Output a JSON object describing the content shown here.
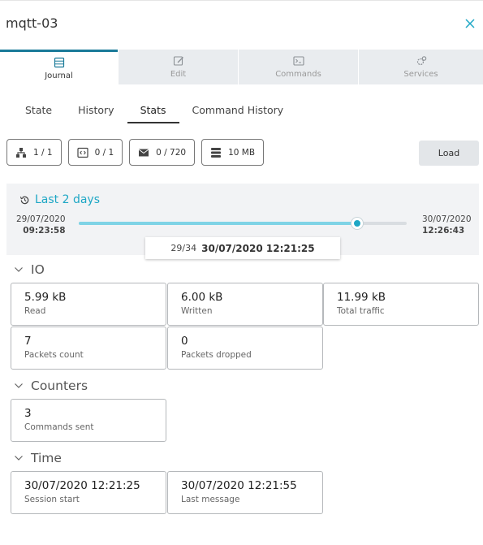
{
  "header": {
    "title": "mqtt-03",
    "close_icon": "close-icon"
  },
  "main_tabs": [
    {
      "label": "Journal",
      "icon": "journal-icon",
      "active": true
    },
    {
      "label": "Edit",
      "icon": "edit-icon",
      "active": false
    },
    {
      "label": "Commands",
      "icon": "terminal-icon",
      "active": false
    },
    {
      "label": "Services",
      "icon": "services-icon",
      "active": false
    }
  ],
  "sub_tabs": [
    {
      "label": "State",
      "active": false
    },
    {
      "label": "History",
      "active": false
    },
    {
      "label": "Stats",
      "active": true
    },
    {
      "label": "Command History",
      "active": false
    }
  ],
  "chips": [
    {
      "icon": "network-icon",
      "text": "1 / 1"
    },
    {
      "icon": "code-icon",
      "text": "0 / 1"
    },
    {
      "icon": "mail-icon",
      "text": "0 / 720"
    },
    {
      "icon": "storage-icon",
      "text": "10 MB"
    }
  ],
  "load_button": "Load",
  "range": {
    "label": "Last 2 days",
    "start_date": "29/07/2020",
    "start_time": "09:23:58",
    "end_date": "30/07/2020",
    "end_time": "12:26:43",
    "slider_fraction": 0.85,
    "tooltip_position": "29/34",
    "tooltip_time": "30/07/2020 12:21:25"
  },
  "sections": {
    "io": {
      "title": "IO",
      "cards": [
        {
          "value": "5.99 kB",
          "label": "Read"
        },
        {
          "value": "6.00 kB",
          "label": "Written"
        },
        {
          "value": "11.99 kB",
          "label": "Total traffic"
        },
        {
          "value": "7",
          "label": "Packets count"
        },
        {
          "value": "0",
          "label": "Packets dropped"
        }
      ]
    },
    "counters": {
      "title": "Counters",
      "cards": [
        {
          "value": "3",
          "label": "Commands sent"
        }
      ]
    },
    "time": {
      "title": "Time",
      "cards": [
        {
          "value": "30/07/2020 12:21:25",
          "label": "Session start"
        },
        {
          "value": "30/07/2020 12:21:55",
          "label": "Last message"
        }
      ]
    }
  },
  "colors": {
    "accent": "#1ea7c5",
    "active_tab_border": "#1a7a99",
    "tab_bg": "#e9ecef"
  }
}
